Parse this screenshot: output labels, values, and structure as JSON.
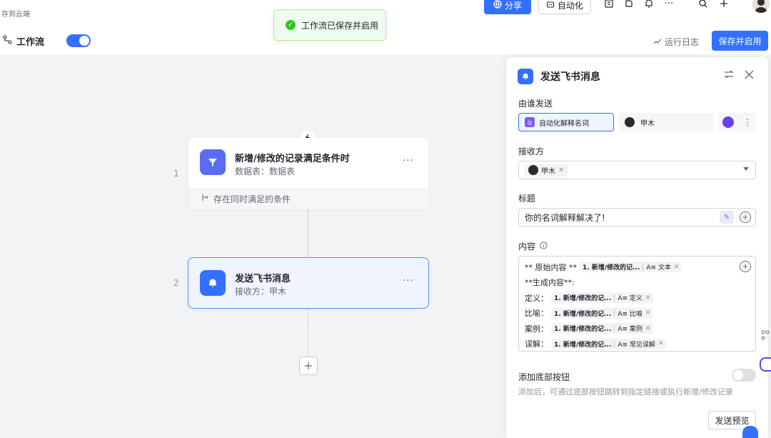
{
  "topbar": {
    "saved_text": "存到云端",
    "share_label": "分享",
    "auto_label": "自动化",
    "more_label": "···"
  },
  "toast": {
    "text": "工作流已保存并启用"
  },
  "subbar": {
    "workflow_label": "工作流",
    "run_log_label": "运行日志",
    "save_enable_label": "保存并启用"
  },
  "nodes": [
    {
      "index": "1",
      "title": "新增/修改的记录满足条件时",
      "subtitle": "数据表：数据表",
      "condition": "存在同时满足的条件",
      "more": "···"
    },
    {
      "index": "2",
      "title": "发送飞书消息",
      "subtitle": "接收方：甲木",
      "more": "···"
    }
  ],
  "panel": {
    "title": "发送飞书消息",
    "sender_label": "由谁发送",
    "sender_options": [
      "自动化解释名词",
      "甲木"
    ],
    "receiver_label": "接收方",
    "receiver_value": "甲木",
    "title_label": "标题",
    "title_value": "你的名词解释解决了!",
    "content_label": "内容",
    "content_rows": [
      {
        "prefix": "** 原始内容 **",
        "source": "1. 新增/修改的记...",
        "field": "A≡ 文本"
      },
      {
        "prefix": "**生成内容**:",
        "source": "",
        "field": ""
      },
      {
        "prefix": "定义：",
        "source": "1. 新增/修改的记...",
        "field": "A≡ 定义"
      },
      {
        "prefix": "比喻：",
        "source": "1. 新增/修改的记...",
        "field": "A≡ 比喻"
      },
      {
        "prefix": "案例：",
        "source": "1. 新增/修改的记...",
        "field": "A≡ 案例"
      },
      {
        "prefix": "误解：",
        "source": "1. 新增/修改的记...",
        "field": "A≡ 常见误解"
      }
    ],
    "bottom_button_label": "添加底部按钮",
    "bottom_button_desc": "添加后，可通过底部按钮跳转到指定链接或执行新增/修改记录",
    "preview_label": "发送预览"
  }
}
